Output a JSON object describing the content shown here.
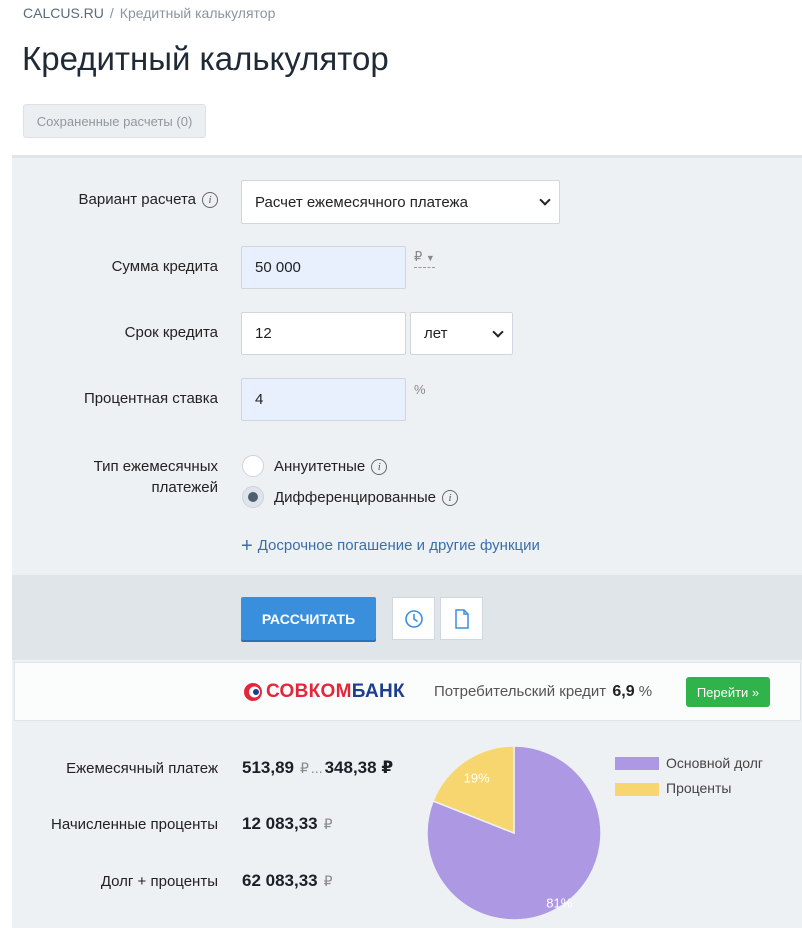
{
  "breadcrumb": {
    "home": "CALCUS.RU",
    "separator": "/",
    "current": "Кредитный калькулятор"
  },
  "page_title": "Кредитный калькулятор",
  "saved_button": "Сохраненные расчеты (0)",
  "form": {
    "variant_label": "Вариант расчета",
    "variant_value": "Расчет ежемесячного платежа",
    "amount_label": "Сумма кредита",
    "amount_value": "50 000",
    "amount_currency": "₽",
    "term_label": "Срок кредита",
    "term_value": "12",
    "term_unit": "лет",
    "rate_label": "Процентная ставка",
    "rate_value": "4",
    "rate_unit": "%",
    "payment_type_label_1": "Тип ежемесячных",
    "payment_type_label_2": "платежей",
    "option_annuity": "Аннуитетные",
    "option_diff": "Дифференцированные",
    "selected_option": "Дифференцированные",
    "more_link": "Досрочное погашение и другие функции"
  },
  "actions": {
    "calculate": "РАССЧИТАТЬ"
  },
  "ad": {
    "bank_part1": "СОВКОМ",
    "bank_part2": "БАНК",
    "text": "Потребительский кредит",
    "rate": "6,9",
    "rate_unit": "%",
    "go_button": "Перейти »"
  },
  "results": {
    "monthly_label": "Ежемесячный платеж",
    "monthly_from": "513,89",
    "monthly_to": "348,38",
    "currency": "₽",
    "ellipsis": "...",
    "interest_label": "Начисленные проценты",
    "interest_value": "12 083,33",
    "total_label": "Долг + проценты",
    "total_value": "62 083,33"
  },
  "chart_data": {
    "type": "pie",
    "categories": [
      "Основной долг",
      "Проценты"
    ],
    "values": [
      81,
      19
    ],
    "labels": [
      "81%",
      "19%"
    ],
    "colors": [
      "#ad98e3",
      "#f8d66f"
    ],
    "legend_position": "right"
  }
}
